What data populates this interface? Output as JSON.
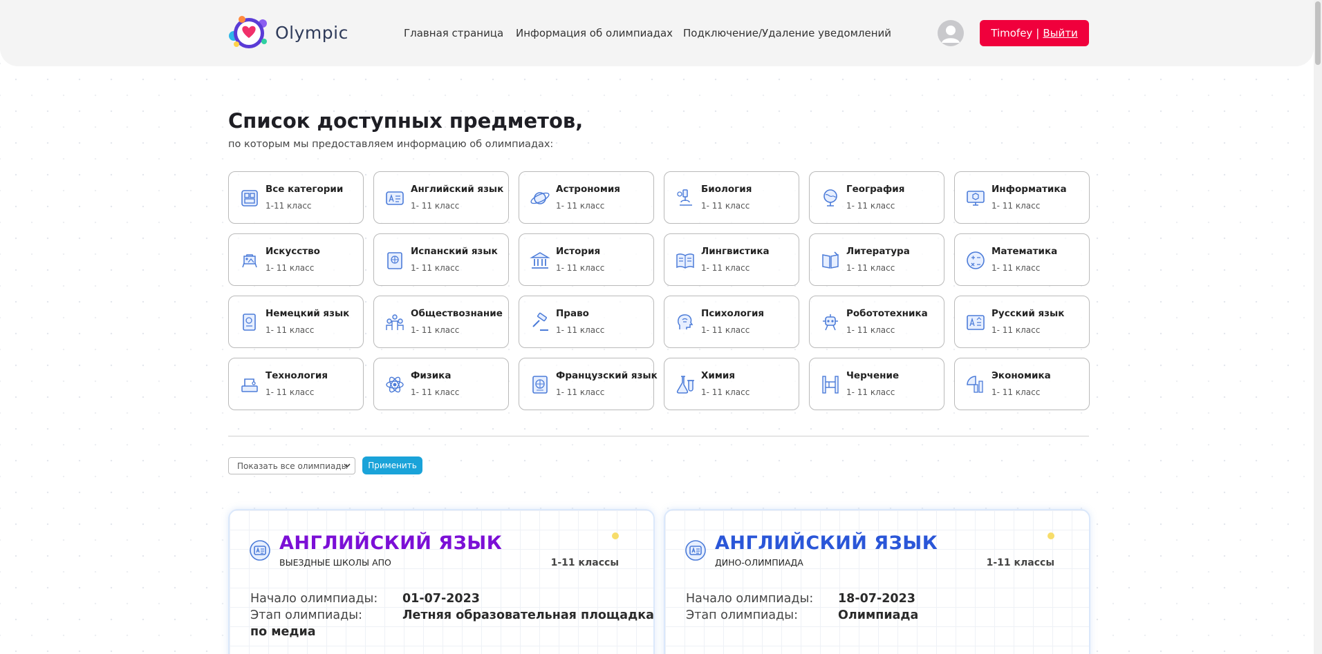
{
  "colors": {
    "accent_red": "#f0003c",
    "accent_blue": "#1aa3d9",
    "icon_blue": "#4b7bd8",
    "purple": "#7b0fd6",
    "royal_blue": "#2a56d8"
  },
  "header": {
    "logo_text": "Olympic",
    "nav": [
      {
        "label": "Главная страница"
      },
      {
        "label": "Информация об олимпиадах"
      },
      {
        "label": "Подключение/Удаление уведомлений"
      }
    ],
    "avatar_icon": "user-avatar-icon",
    "user_name": "Timofey",
    "separator": "|",
    "logout_label": "Выйти"
  },
  "main": {
    "title": "Список доступных предметов,",
    "subtitle": "по которым мы предоставляем информацию об олимпиадах:"
  },
  "categories": [
    {
      "name": "Все категории",
      "grade": "1-11 класс",
      "icon": "all-categories-icon"
    },
    {
      "name": "Английский язык",
      "grade": "1- 11 класс",
      "icon": "english-icon"
    },
    {
      "name": "Астрономия",
      "grade": "1- 11 класс",
      "icon": "astronomy-icon"
    },
    {
      "name": "Биология",
      "grade": "1- 11 класс",
      "icon": "biology-icon"
    },
    {
      "name": "География",
      "grade": "1- 11 класс",
      "icon": "geography-icon"
    },
    {
      "name": "Информатика",
      "grade": "1- 11 класс",
      "icon": "informatics-icon"
    },
    {
      "name": "Искусство",
      "grade": "1- 11 класс",
      "icon": "art-icon"
    },
    {
      "name": "Испанский язык",
      "grade": "1- 11 класс",
      "icon": "spanish-icon"
    },
    {
      "name": "История",
      "grade": "1- 11 класс",
      "icon": "history-icon"
    },
    {
      "name": "Лингвистика",
      "grade": "1- 11 класс",
      "icon": "linguistics-icon"
    },
    {
      "name": "Литература",
      "grade": "1- 11 класс",
      "icon": "literature-icon"
    },
    {
      "name": "Математика",
      "grade": "1- 11 класс",
      "icon": "math-icon"
    },
    {
      "name": "Немецкий язык",
      "grade": "1- 11 класс",
      "icon": "german-icon"
    },
    {
      "name": "Обществознание",
      "grade": "1- 11 класс",
      "icon": "social-studies-icon"
    },
    {
      "name": "Право",
      "grade": "1- 11 класс",
      "icon": "law-icon"
    },
    {
      "name": "Психология",
      "grade": "1- 11 класс",
      "icon": "psychology-icon"
    },
    {
      "name": "Робототехника",
      "grade": "1- 11 класс",
      "icon": "robotics-icon"
    },
    {
      "name": "Русский язык",
      "grade": "1- 11 класс",
      "icon": "russian-icon"
    },
    {
      "name": "Технология",
      "grade": "1- 11 класс",
      "icon": "technology-icon"
    },
    {
      "name": "Физика",
      "grade": "1- 11 класс",
      "icon": "physics-icon"
    },
    {
      "name": "Французский язык",
      "grade": "1- 11 класс",
      "icon": "french-icon"
    },
    {
      "name": "Химия",
      "grade": "1- 11 класс",
      "icon": "chemistry-icon"
    },
    {
      "name": "Черчение",
      "grade": "1- 11 класс",
      "icon": "drafting-icon"
    },
    {
      "name": "Экономика",
      "grade": "1- 11 класс",
      "icon": "economics-icon"
    }
  ],
  "filter": {
    "selected": "Показать все олимпиады",
    "apply_label": "Применить"
  },
  "olympiads": [
    {
      "subject": "АНГЛИЙСКИЙ ЯЗЫК",
      "subject_color": "#7b0fd6",
      "school": "ВЫЕЗДНЫЕ ШКОЛЫ АПО",
      "grades": "1-11 классы",
      "start_label": "Начало олимпиады:",
      "start_value": "01-07-2023",
      "stage_label": "Этап олимпиады:",
      "stage_value": "Летняя образовательная площадка",
      "stage_cont": "по медиа"
    },
    {
      "subject": "АНГЛИЙСКИЙ ЯЗЫК",
      "subject_color": "#2a56d8",
      "school": "ДИНО-ОЛИМПИАДА",
      "grades": "1-11 классы",
      "start_label": "Начало олимпиады:",
      "start_value": "18-07-2023",
      "stage_label": "Этап олимпиады:",
      "stage_value": "Олимпиада",
      "stage_cont": ""
    }
  ]
}
